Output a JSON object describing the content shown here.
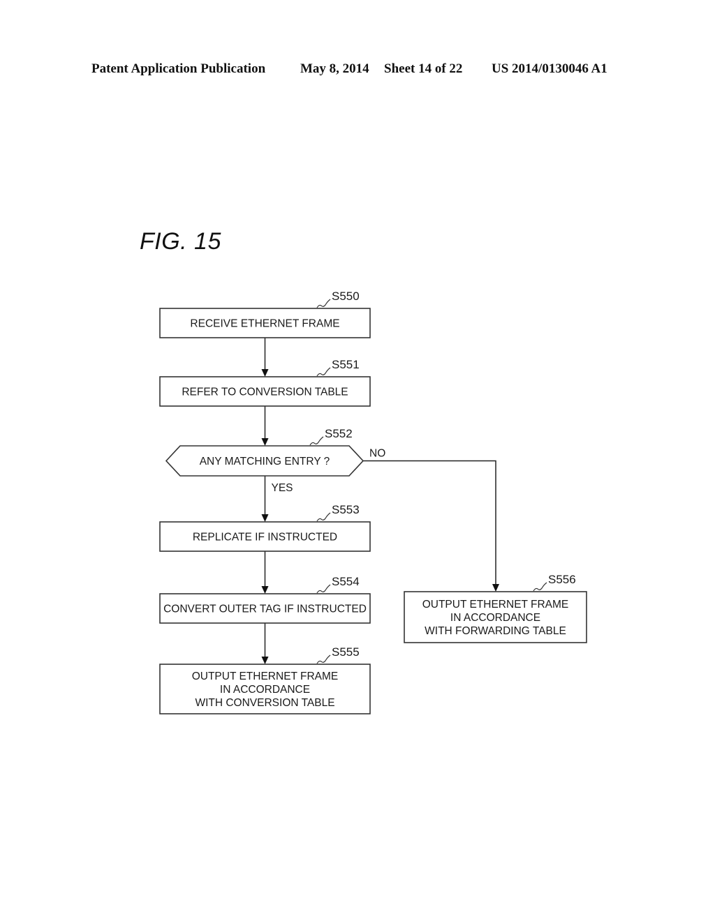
{
  "header": {
    "publication": "Patent Application Publication",
    "date": "May 8, 2014",
    "sheet": "Sheet 14 of 22",
    "number": "US 2014/0130046 A1"
  },
  "figure": {
    "title": "FIG. 15"
  },
  "flowchart": {
    "steps": [
      {
        "id": "S550",
        "type": "process",
        "lines": [
          "RECEIVE ETHERNET FRAME"
        ]
      },
      {
        "id": "S551",
        "type": "process",
        "lines": [
          "REFER TO CONVERSION TABLE"
        ]
      },
      {
        "id": "S552",
        "type": "decision",
        "lines": [
          "ANY MATCHING ENTRY ?"
        ]
      },
      {
        "id": "S553",
        "type": "process",
        "lines": [
          "REPLICATE IF INSTRUCTED"
        ]
      },
      {
        "id": "S554",
        "type": "process",
        "lines": [
          "CONVERT OUTER TAG IF INSTRUCTED"
        ]
      },
      {
        "id": "S555",
        "type": "process",
        "lines": [
          "OUTPUT ETHERNET FRAME",
          "IN ACCORDANCE",
          "WITH CONVERSION TABLE"
        ]
      },
      {
        "id": "S556",
        "type": "process",
        "lines": [
          "OUTPUT ETHERNET FRAME",
          "IN ACCORDANCE",
          "WITH FORWARDING TABLE"
        ]
      }
    ],
    "branches": {
      "yes": "YES",
      "no": "NO"
    },
    "edges": [
      {
        "from": "S550",
        "to": "S551"
      },
      {
        "from": "S551",
        "to": "S552"
      },
      {
        "from": "S552",
        "to": "S553",
        "label": "YES"
      },
      {
        "from": "S552",
        "to": "S556",
        "label": "NO"
      },
      {
        "from": "S553",
        "to": "S554"
      },
      {
        "from": "S554",
        "to": "S555"
      }
    ]
  }
}
